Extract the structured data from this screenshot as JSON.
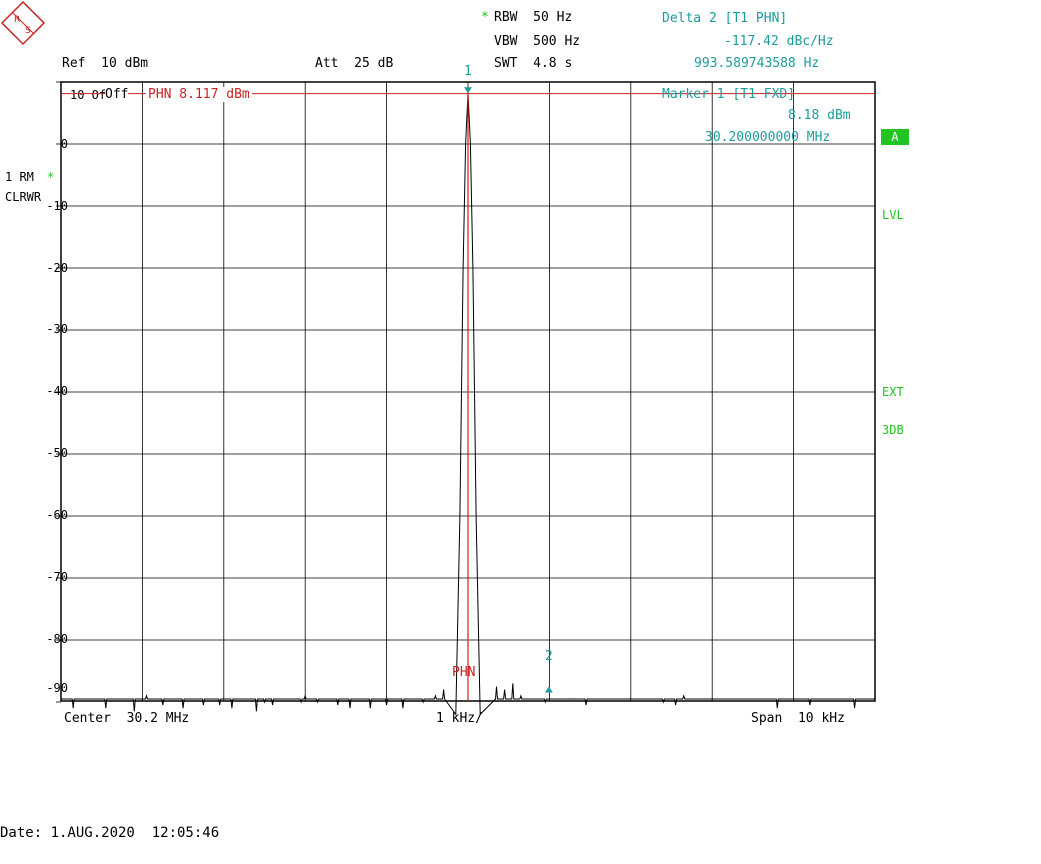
{
  "header": {
    "rbw": "RBW  50 Hz",
    "vbw": "VBW  500 Hz",
    "swt": "SWT  4.8 s",
    "ref": "Ref  10 dBm",
    "att": "Att  25 dB",
    "rbw_star": "*"
  },
  "delta_marker": {
    "title": "Delta 2 [T1 PHN]",
    "value": "-117.42 dBc/Hz",
    "freq": "993.589743588 Hz"
  },
  "marker1": {
    "title": "Marker 1 [T1 FXD]",
    "level": "8.18 dBm",
    "freq": "30.200000000 MHz"
  },
  "offset_label": {
    "prefix": "10  Off",
    "phn": "PHN 8.117 dBm"
  },
  "trace_info": {
    "mode": "1 RM",
    "star": "*",
    "clrwr": "CLRWR"
  },
  "side_labels": {
    "a": "A",
    "lvl": "LVL",
    "ext": "EXT",
    "db3": "3DB"
  },
  "footer": {
    "center": "Center  30.2 MHz",
    "div": "1 kHz/",
    "span": "Span  10 kHz",
    "date": "Date: 1.AUG.2020  12:05:46"
  },
  "markers": {
    "m1_label": "1",
    "m2_label": "2",
    "phn_label": "PHN"
  },
  "colors": {
    "trace": "#000000",
    "grid": "#000000",
    "marker": "#1c9c9c",
    "phn_line": "#cc2222",
    "indicator": "#22c422"
  },
  "chart_data": {
    "type": "line",
    "xlabel": "",
    "ylabel": "",
    "x_unit": "kHz offset from center",
    "xlim": [
      -5,
      5
    ],
    "ylim": [
      -92,
      10
    ],
    "yticks": [
      0,
      -10,
      -20,
      -30,
      -40,
      -50,
      -60,
      -70,
      -80,
      -90
    ],
    "grid": true,
    "series": [
      {
        "name": "",
        "peak": {
          "x": 0.0,
          "y": 8.18
        },
        "main_lobe": [
          {
            "x": -0.15,
            "y": -92
          },
          {
            "x": -0.1,
            "y": -60
          },
          {
            "x": -0.06,
            "y": -20
          },
          {
            "x": -0.03,
            "y": 0
          },
          {
            "x": 0.0,
            "y": 8.18
          },
          {
            "x": 0.03,
            "y": 0
          },
          {
            "x": 0.06,
            "y": -20
          },
          {
            "x": 0.1,
            "y": -60
          },
          {
            "x": 0.15,
            "y": -92
          }
        ],
        "spurs": [
          {
            "x": -4.85,
            "y": -91
          },
          {
            "x": -4.45,
            "y": -91
          },
          {
            "x": -4.1,
            "y": -91.5
          },
          {
            "x": -3.95,
            "y": -89
          },
          {
            "x": -3.75,
            "y": -90.5
          },
          {
            "x": -3.5,
            "y": -91
          },
          {
            "x": -3.25,
            "y": -90.5
          },
          {
            "x": -3.05,
            "y": -90.5
          },
          {
            "x": -2.9,
            "y": -91
          },
          {
            "x": -2.6,
            "y": -91.5
          },
          {
            "x": -2.5,
            "y": -90
          },
          {
            "x": -2.4,
            "y": -90.5
          },
          {
            "x": -2.05,
            "y": -90
          },
          {
            "x": -2.0,
            "y": -89
          },
          {
            "x": -1.85,
            "y": -90
          },
          {
            "x": -1.6,
            "y": -90.5
          },
          {
            "x": -1.45,
            "y": -91
          },
          {
            "x": -1.2,
            "y": -91
          },
          {
            "x": -1.0,
            "y": -90.5
          },
          {
            "x": -0.8,
            "y": -91
          },
          {
            "x": -0.55,
            "y": -90
          },
          {
            "x": -0.4,
            "y": -89
          },
          {
            "x": -0.3,
            "y": -88
          },
          {
            "x": 0.35,
            "y": -87.5
          },
          {
            "x": 0.45,
            "y": -88
          },
          {
            "x": 0.55,
            "y": -87
          },
          {
            "x": 0.65,
            "y": -89
          },
          {
            "x": 0.95,
            "y": -90
          },
          {
            "x": 1.25,
            "y": -89.5
          },
          {
            "x": 1.45,
            "y": -90.5
          },
          {
            "x": 2.4,
            "y": -90
          },
          {
            "x": 2.55,
            "y": -90.5
          },
          {
            "x": 2.65,
            "y": -89
          },
          {
            "x": 3.8,
            "y": -91
          },
          {
            "x": 4.2,
            "y": -90.5
          },
          {
            "x": 4.75,
            "y": -91
          }
        ]
      }
    ],
    "annotations": [
      {
        "label": "1",
        "x": 0.0,
        "y": 8.18,
        "kind": "marker"
      },
      {
        "label": "2",
        "x": 0.9936,
        "y": -87.5,
        "kind": "delta-marker"
      },
      {
        "label": "PHN",
        "x": 0.0,
        "kind": "reference-line",
        "y": 8.117
      }
    ]
  }
}
